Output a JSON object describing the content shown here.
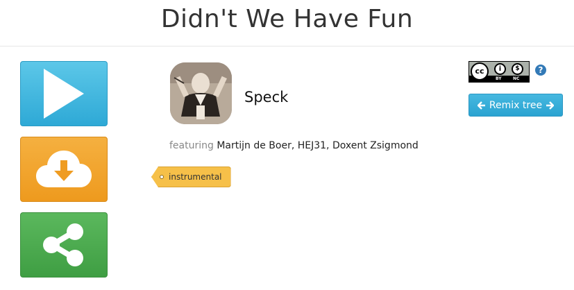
{
  "page": {
    "title": "Didn't We Have Fun"
  },
  "actions": {
    "play": {
      "icon": "play-icon",
      "color": "#3bb3e0"
    },
    "download": {
      "icon": "cloud-download-icon",
      "color": "#f0a02c"
    },
    "share": {
      "icon": "share-icon",
      "color": "#4caf50"
    }
  },
  "track": {
    "artist": "Speck",
    "featuring_label": "featuring",
    "featuring_names": "Martijn de Boer, HEJ31, Doxent Zsigmond",
    "tags": [
      "instrumental"
    ]
  },
  "license": {
    "badge_text": {
      "cc": "cc",
      "by": "BY",
      "nc": "NC"
    },
    "help_icon": "question-circle-icon"
  },
  "remix": {
    "label": "Remix tree",
    "left_icon": "arrow-left-icon",
    "right_icon": "arrow-right-icon"
  }
}
